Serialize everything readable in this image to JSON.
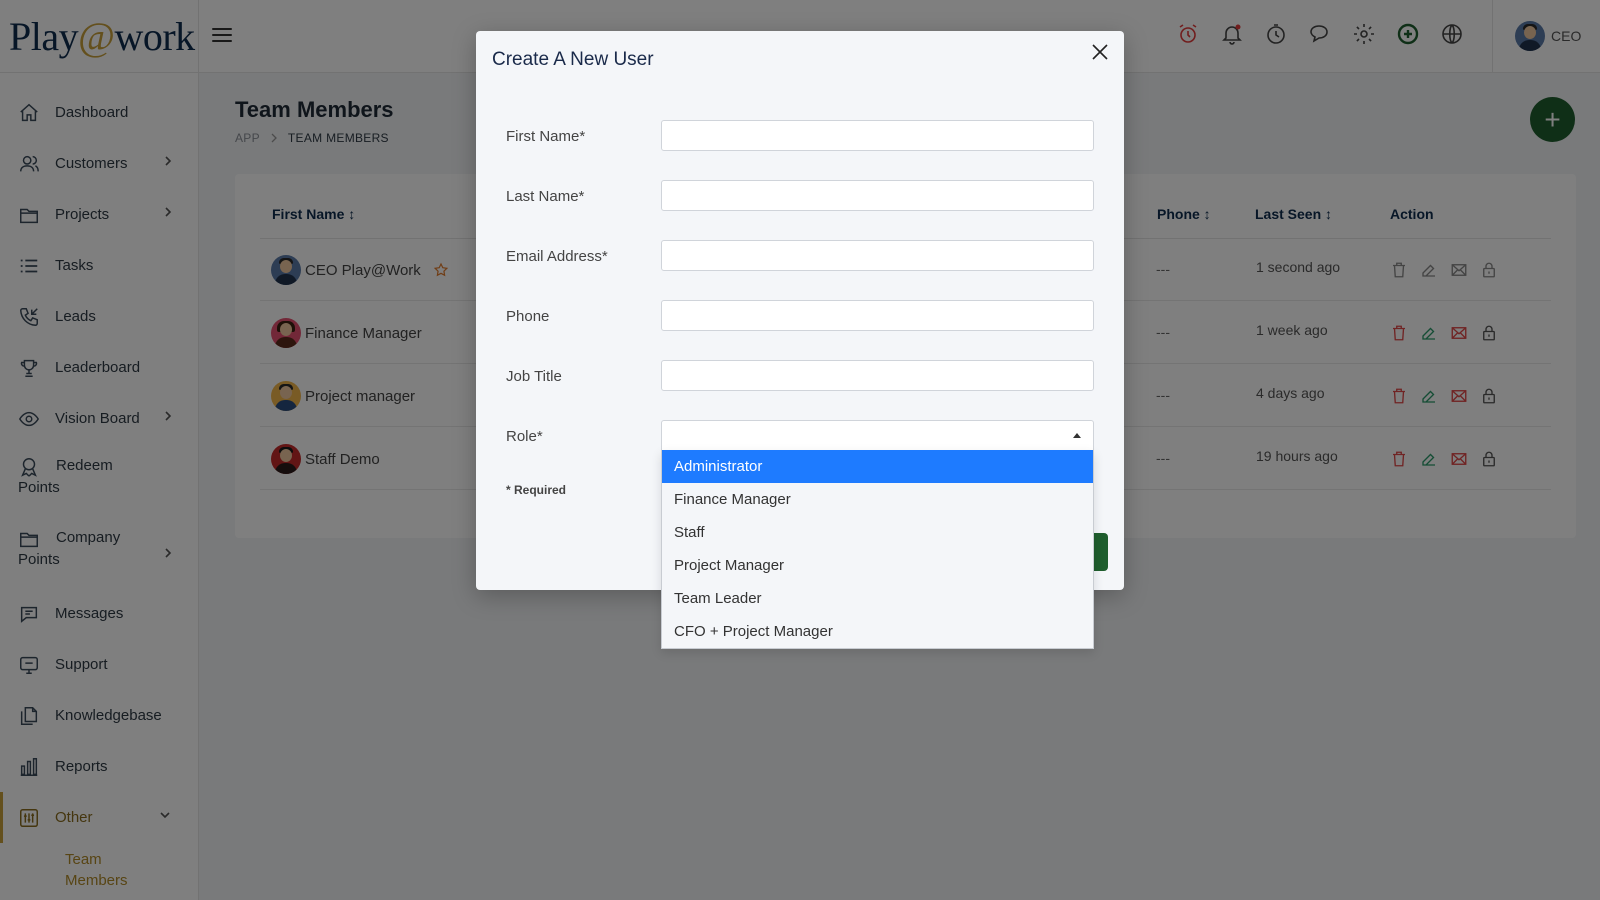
{
  "logo": {
    "part1": "Play",
    "at": "@",
    "part2": "work"
  },
  "sidebar": {
    "items": [
      {
        "label": "Dashboard"
      },
      {
        "label": "Customers"
      },
      {
        "label": "Projects"
      },
      {
        "label": "Tasks"
      },
      {
        "label": "Leads"
      },
      {
        "label": "Leaderboard"
      },
      {
        "label": "Vision Board"
      },
      {
        "line1": "Redeem",
        "line2": "Points"
      },
      {
        "line1": "Company",
        "line2": "Points"
      },
      {
        "label": "Messages"
      },
      {
        "label": "Support"
      },
      {
        "label": "Knowledgebase"
      },
      {
        "label": "Reports"
      },
      {
        "label": "Other"
      }
    ],
    "sub_item": "Team Members"
  },
  "header": {
    "user_label": "CEO"
  },
  "page": {
    "title": "Team Members",
    "breadcrumb": [
      "APP",
      "TEAM MEMBERS"
    ],
    "fab": "+"
  },
  "table": {
    "headers": {
      "first_name": "First Name ↕",
      "phone": "Phone ↕",
      "last_seen": "Last Seen ↕",
      "action": "Action"
    },
    "rows": [
      {
        "name": "CEO Play@Work",
        "phone": "---",
        "last_seen": "1 second ago"
      },
      {
        "name": "Finance Manager",
        "phone": "---",
        "last_seen": "1 week ago"
      },
      {
        "name": "Project manager",
        "phone": "---",
        "last_seen": "4 days ago"
      },
      {
        "name": "Staff Demo",
        "phone": "---",
        "last_seen": "19 hours ago"
      }
    ]
  },
  "modal": {
    "title": "Create A New User",
    "fields": {
      "first_name": "First Name*",
      "last_name": "Last Name*",
      "email": "Email Address*",
      "phone": "Phone",
      "job_title": "Job Title",
      "role": "Role*"
    },
    "required_note": "* Required",
    "role_options": [
      "Administrator",
      "Finance Manager",
      "Staff",
      "Project Manager",
      "Team Leader",
      "CFO + Project Manager"
    ],
    "highlighted_option": "Administrator"
  },
  "colors": {
    "brand_green": "#1f5e2e",
    "gold": "#c9a13b",
    "highlight_blue": "#1e7bff",
    "navy": "#0f2d4e"
  }
}
